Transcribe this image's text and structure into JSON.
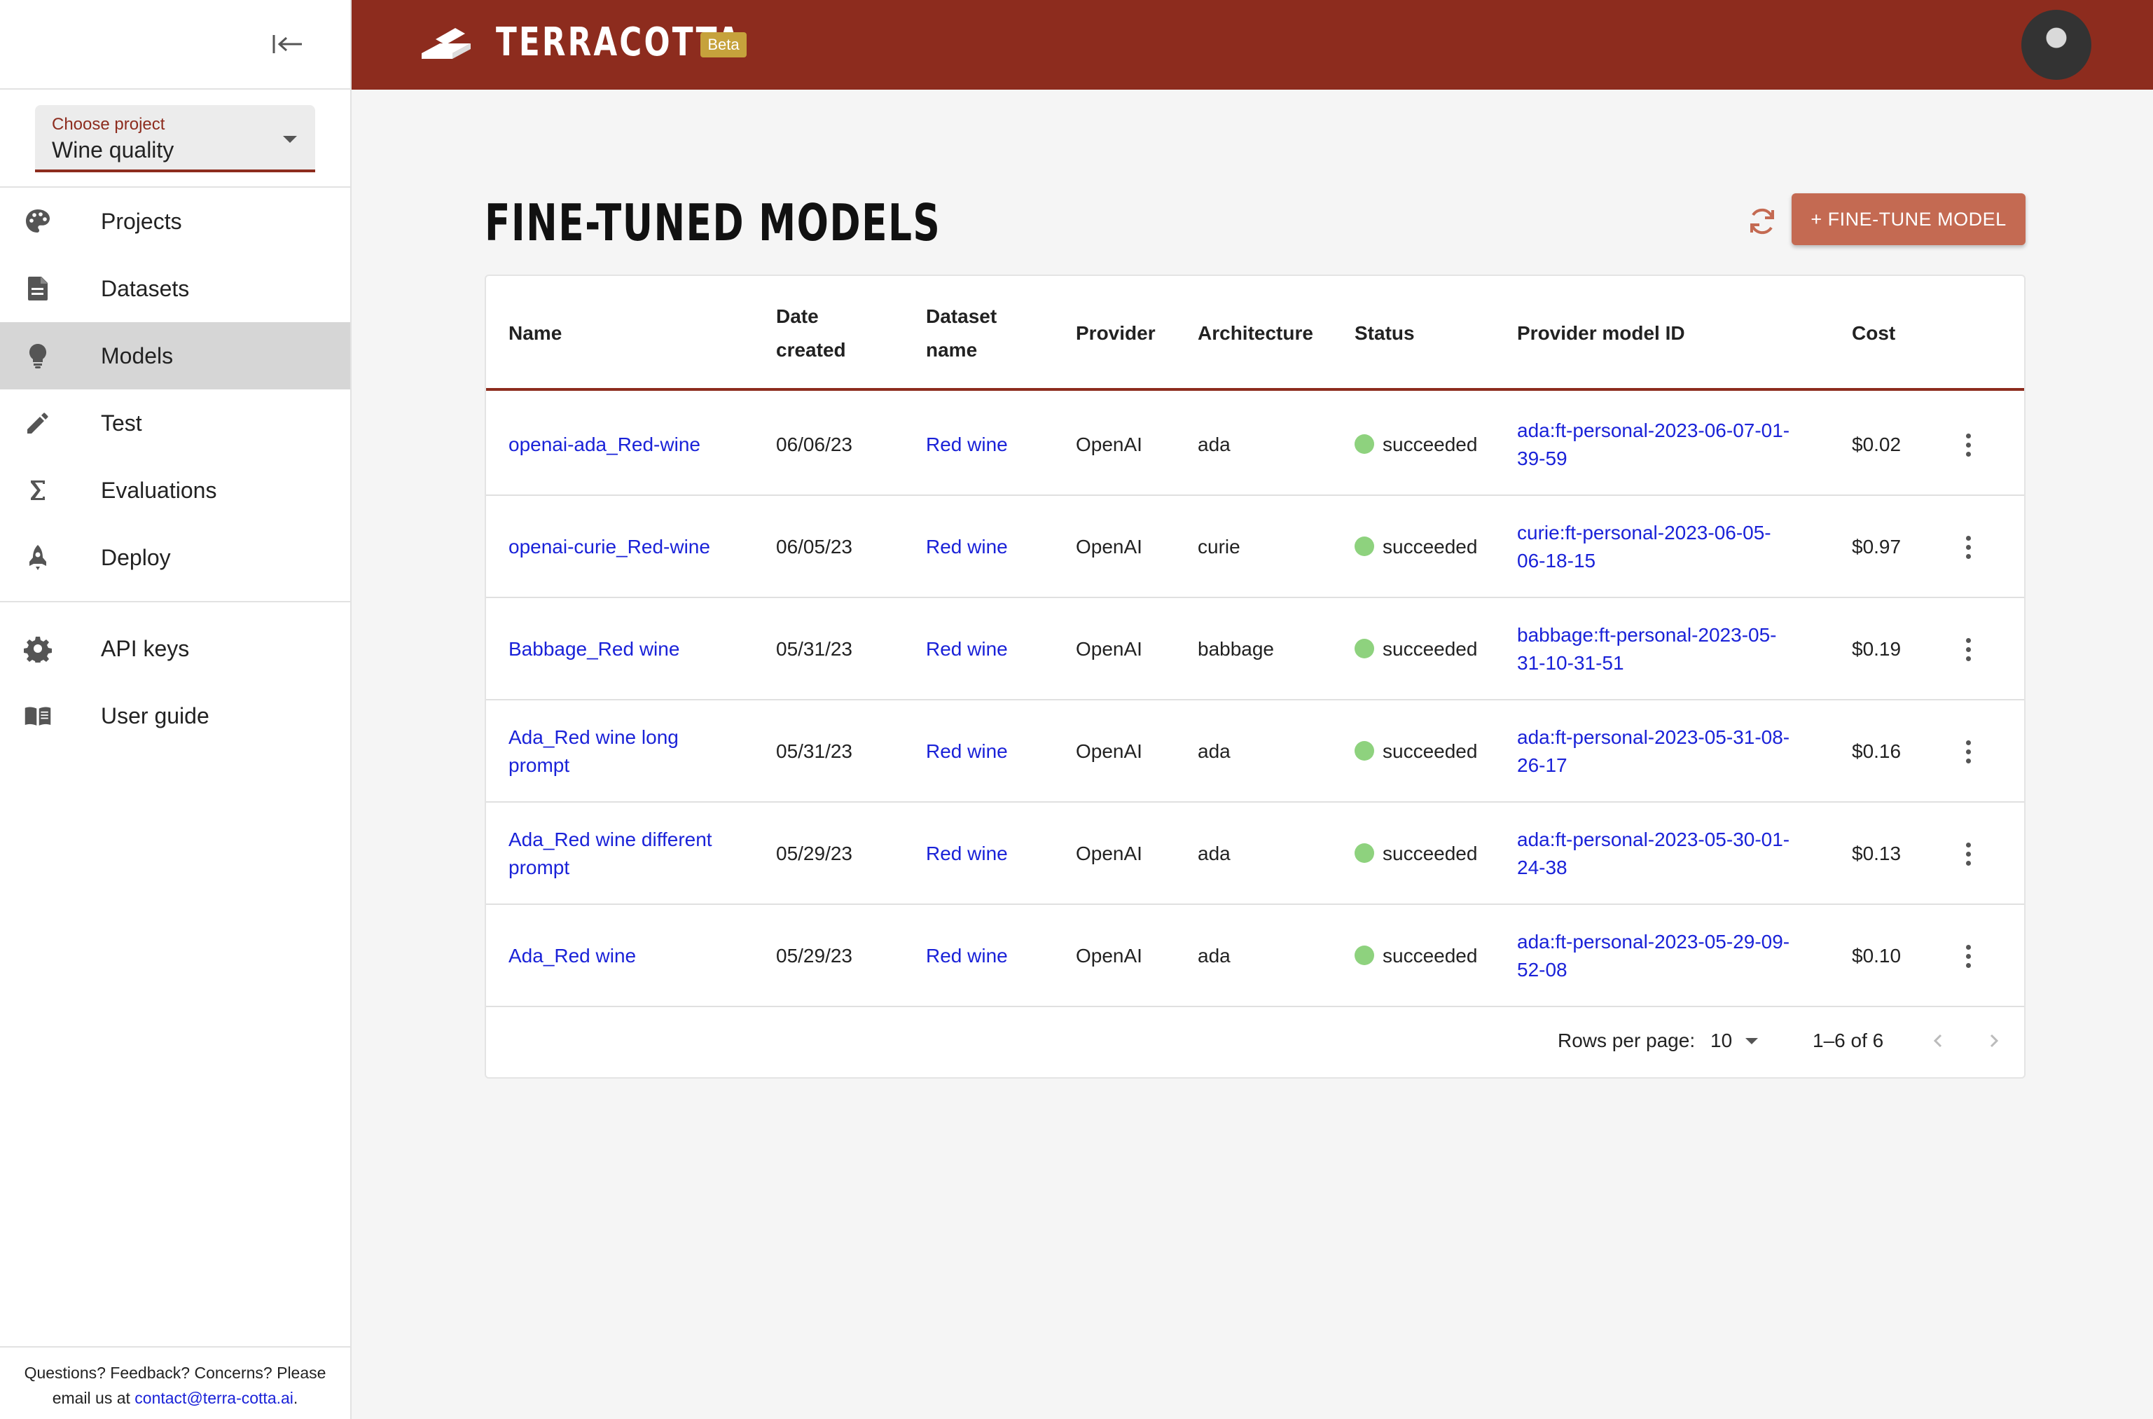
{
  "brand": {
    "name": "TERRACOTTA",
    "badge": "Beta"
  },
  "sidebar": {
    "project_select": {
      "label": "Choose project",
      "value": "Wine quality"
    },
    "items": [
      {
        "label": "Projects",
        "icon": "palette-icon"
      },
      {
        "label": "Datasets",
        "icon": "document-icon"
      },
      {
        "label": "Models",
        "icon": "lightbulb-icon",
        "active": true
      },
      {
        "label": "Test",
        "icon": "pencil-icon"
      },
      {
        "label": "Evaluations",
        "icon": "sigma-icon"
      },
      {
        "label": "Deploy",
        "icon": "rocket-icon"
      }
    ],
    "items2": [
      {
        "label": "API keys",
        "icon": "gear-icon"
      },
      {
        "label": "User guide",
        "icon": "book-icon"
      }
    ],
    "footer": {
      "line1": "Questions? Feedback? Concerns? Please",
      "line2_prefix": "email us at ",
      "email": "contact@terra-cotta.ai",
      "line2_suffix": "."
    }
  },
  "main": {
    "title": "FINE-TUNED MODELS",
    "finetune_button": "+ FINE-TUNE MODEL",
    "table": {
      "headers": {
        "name": "Name",
        "date_created": [
          "Date",
          "created"
        ],
        "dataset_name": [
          "Dataset",
          "name"
        ],
        "provider": "Provider",
        "architecture": "Architecture",
        "status": "Status",
        "provider_model_id": "Provider model ID",
        "cost": "Cost"
      },
      "rows": [
        {
          "name": [
            "openai-ada_Red-wine"
          ],
          "date": "06/06/23",
          "dataset": "Red wine",
          "provider": "OpenAI",
          "architecture": "ada",
          "status": "succeeded",
          "model_id": [
            "ada:ft-personal-2023-06-07-01-",
            "39-59"
          ],
          "cost": "$0.02"
        },
        {
          "name": [
            "openai-curie_Red-wine"
          ],
          "date": "06/05/23",
          "dataset": "Red wine",
          "provider": "OpenAI",
          "architecture": "curie",
          "status": "succeeded",
          "model_id": [
            "curie:ft-personal-2023-06-05-",
            "06-18-15"
          ],
          "cost": "$0.97"
        },
        {
          "name": [
            "Babbage_Red wine"
          ],
          "date": "05/31/23",
          "dataset": "Red wine",
          "provider": "OpenAI",
          "architecture": "babbage",
          "status": "succeeded",
          "model_id": [
            "babbage:ft-personal-2023-05-",
            "31-10-31-51"
          ],
          "cost": "$0.19"
        },
        {
          "name": [
            "Ada_Red wine long",
            "prompt"
          ],
          "date": "05/31/23",
          "dataset": "Red wine",
          "provider": "OpenAI",
          "architecture": "ada",
          "status": "succeeded",
          "model_id": [
            "ada:ft-personal-2023-05-31-08-",
            "26-17"
          ],
          "cost": "$0.16"
        },
        {
          "name": [
            "Ada_Red wine different",
            "prompt"
          ],
          "date": "05/29/23",
          "dataset": "Red wine",
          "provider": "OpenAI",
          "architecture": "ada",
          "status": "succeeded",
          "model_id": [
            "ada:ft-personal-2023-05-30-01-",
            "24-38"
          ],
          "cost": "$0.13"
        },
        {
          "name": [
            "Ada_Red wine"
          ],
          "date": "05/29/23",
          "dataset": "Red wine",
          "provider": "OpenAI",
          "architecture": "ada",
          "status": "succeeded",
          "model_id": [
            "ada:ft-personal-2023-05-29-09-",
            "52-08"
          ],
          "cost": "$0.10"
        }
      ]
    },
    "pagination": {
      "rows_per_page_label": "Rows per page:",
      "rows_per_page": "10",
      "range": "1–6 of 6"
    }
  },
  "colors": {
    "brand": "#8d2c1e",
    "button": "#c46a52",
    "badge": "#c6a23c",
    "link": "#1a22d8",
    "success": "#8ed27e"
  }
}
